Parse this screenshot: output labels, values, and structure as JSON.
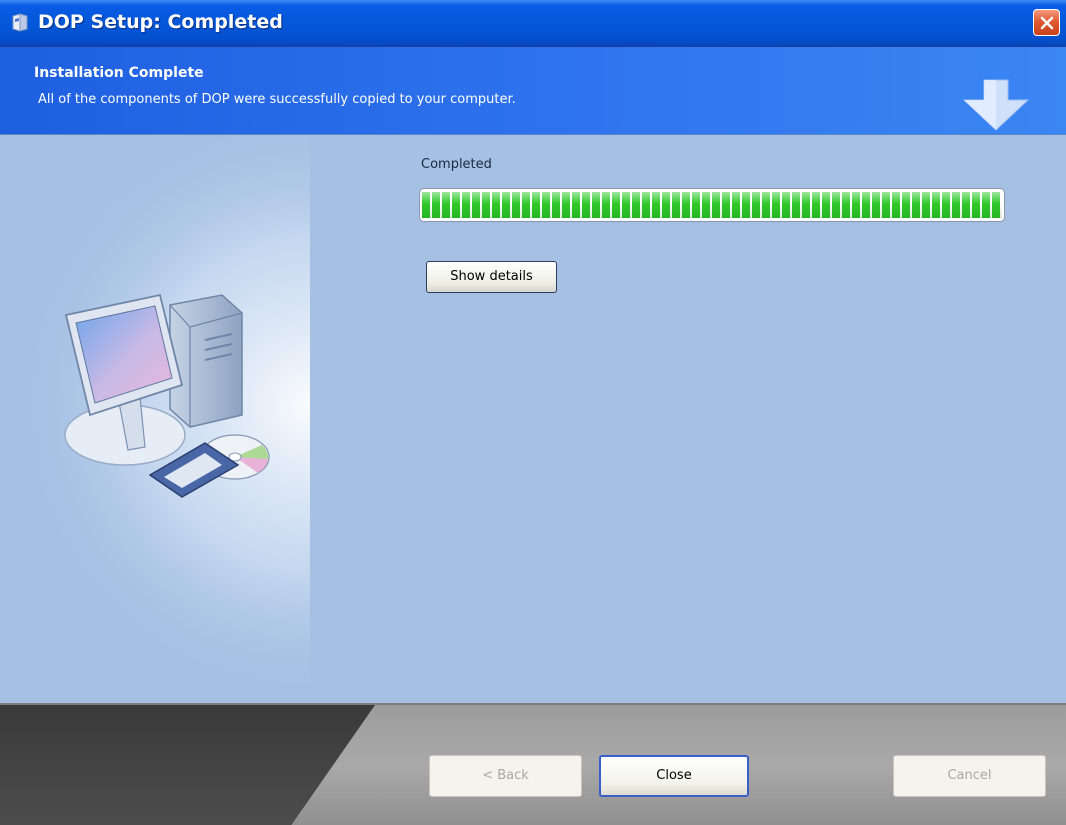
{
  "window": {
    "title": "DOP Setup: Completed",
    "app_icon": "setup-icon",
    "close_icon": "close-icon"
  },
  "header": {
    "title": "Installation Complete",
    "subtitle": "All of the components of DOP were successfully copied to your computer.",
    "icon": "download-arrow-icon"
  },
  "main": {
    "status_label": "Completed",
    "progress_fraction": 1.0,
    "show_details_label": "Show details",
    "illustration": "computer-with-cd-icon"
  },
  "footer": {
    "back_label": "< Back",
    "close_label": "Close",
    "cancel_label": "Cancel",
    "back_enabled": false,
    "cancel_enabled": false
  },
  "colors": {
    "title_bar": "#0458d9",
    "header_band": "#2f74ee",
    "body_background": "#a5c0e3",
    "progress_green": "#2ec92b",
    "footer_dark": "#4a4a4a"
  }
}
